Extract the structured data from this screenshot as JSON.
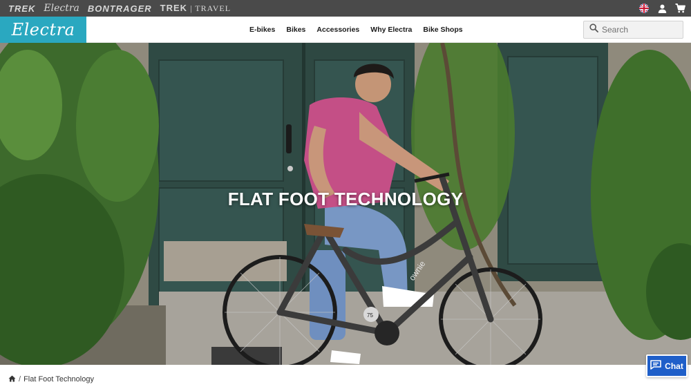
{
  "brand_bar": {
    "brands": [
      "TREK",
      "Electra",
      "BONTRAGER",
      "TREK",
      "TRAVEL"
    ],
    "language_icon": "uk-flag-icon",
    "account_icon": "user-icon",
    "cart_icon": "cart-icon"
  },
  "nav": {
    "logo_text": "Electra",
    "links": [
      "E-bikes",
      "Bikes",
      "Accessories",
      "Why Electra",
      "Bike Shops"
    ],
    "search_placeholder": "Search",
    "search_icon": "search-icon"
  },
  "hero": {
    "title": "FLAT FOOT TECHNOLOGY",
    "frame_text": "ownie",
    "chainring_text": "75"
  },
  "chat": {
    "label": "Chat",
    "icon": "chat-bubble-icon"
  },
  "breadcrumb": {
    "home_icon": "home-icon",
    "separator": "/",
    "current": "Flat Foot Technology"
  },
  "colors": {
    "brand_bar_bg": "#4a4a4a",
    "logo_bg": "#2aa8c0",
    "chat_bg": "#1f5fc9",
    "door_green": "#2f4a44"
  }
}
